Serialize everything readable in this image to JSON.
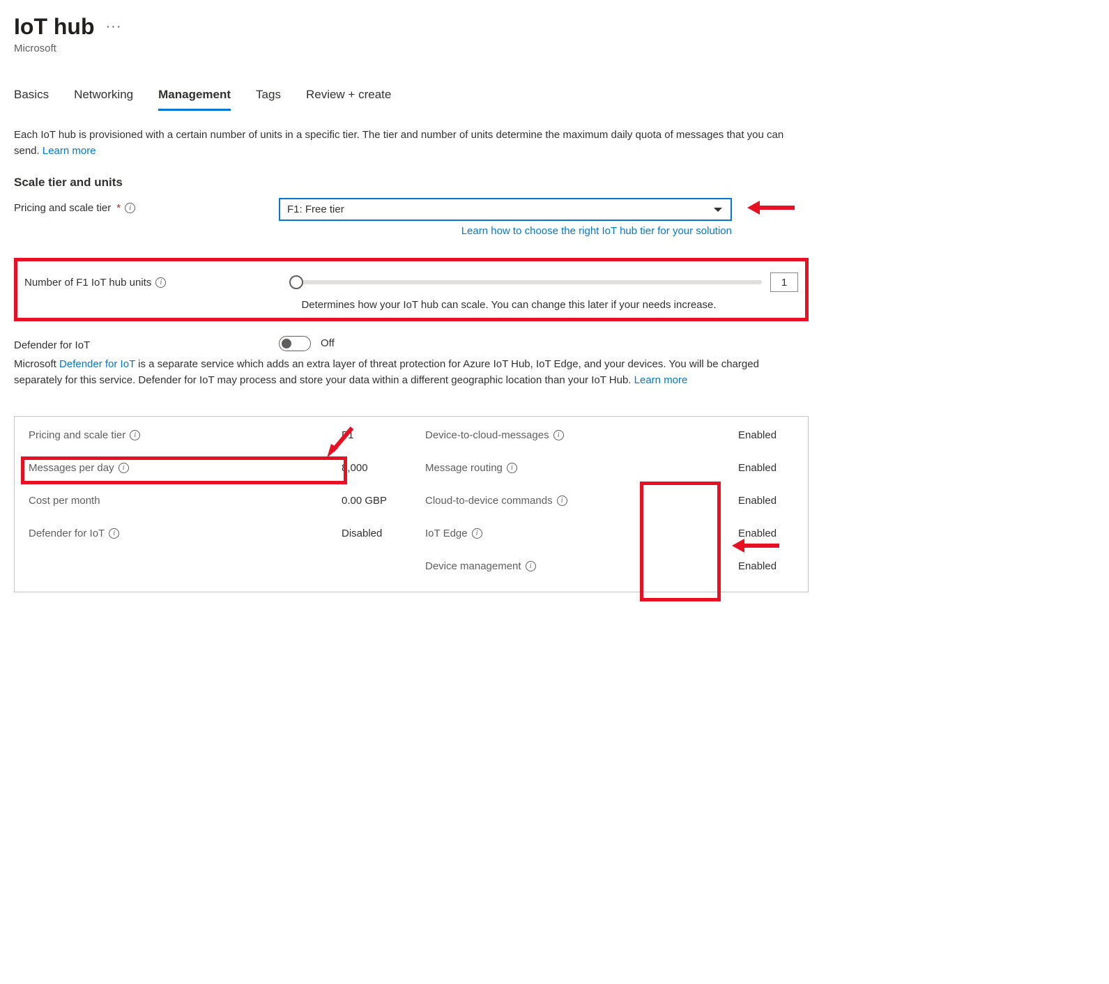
{
  "header": {
    "title": "IoT hub",
    "subtitle": "Microsoft"
  },
  "tabs": {
    "basics": "Basics",
    "networking": "Networking",
    "management": "Management",
    "tags": "Tags",
    "review": "Review + create"
  },
  "intro": {
    "text": "Each IoT hub is provisioned with a certain number of units in a specific tier. The tier and number of units determine the maximum daily quota of messages that you can send.  ",
    "learn_more": "Learn more"
  },
  "scale": {
    "heading": "Scale tier and units",
    "pricing_label": "Pricing and scale tier",
    "pricing_value": "F1: Free tier",
    "tier_link": "Learn how to choose the right IoT hub tier for your solution",
    "units_label": "Number of F1 IoT hub units",
    "units_value": "1",
    "units_caption": "Determines how your IoT hub can scale. You can change this later if your needs increase."
  },
  "defender": {
    "label": "Defender for IoT",
    "toggle_state": "Off",
    "desc_prefix": "Microsoft ",
    "desc_link": "Defender for IoT",
    "desc_rest": " is a separate service which adds an extra layer of threat protection for Azure IoT Hub, IoT Edge, and your devices. You will be charged separately for this service. Defender for IoT may process and store your data within a different geographic location than your IoT Hub. ",
    "learn_more": "Learn more"
  },
  "summary": {
    "left": {
      "pricing_label": "Pricing and scale tier",
      "pricing_value": "F1",
      "messages_label": "Messages per day",
      "messages_value": "8,000",
      "cost_label": "Cost per month",
      "cost_value": "0.00 GBP",
      "defender_label": "Defender for IoT",
      "defender_value": "Disabled"
    },
    "right": {
      "d2c_label": "Device-to-cloud-messages",
      "d2c_value": "Enabled",
      "routing_label": "Message routing",
      "routing_value": "Enabled",
      "c2d_label": "Cloud-to-device commands",
      "c2d_value": "Enabled",
      "edge_label": "IoT Edge",
      "edge_value": "Enabled",
      "mgmt_label": "Device management",
      "mgmt_value": "Enabled"
    }
  }
}
